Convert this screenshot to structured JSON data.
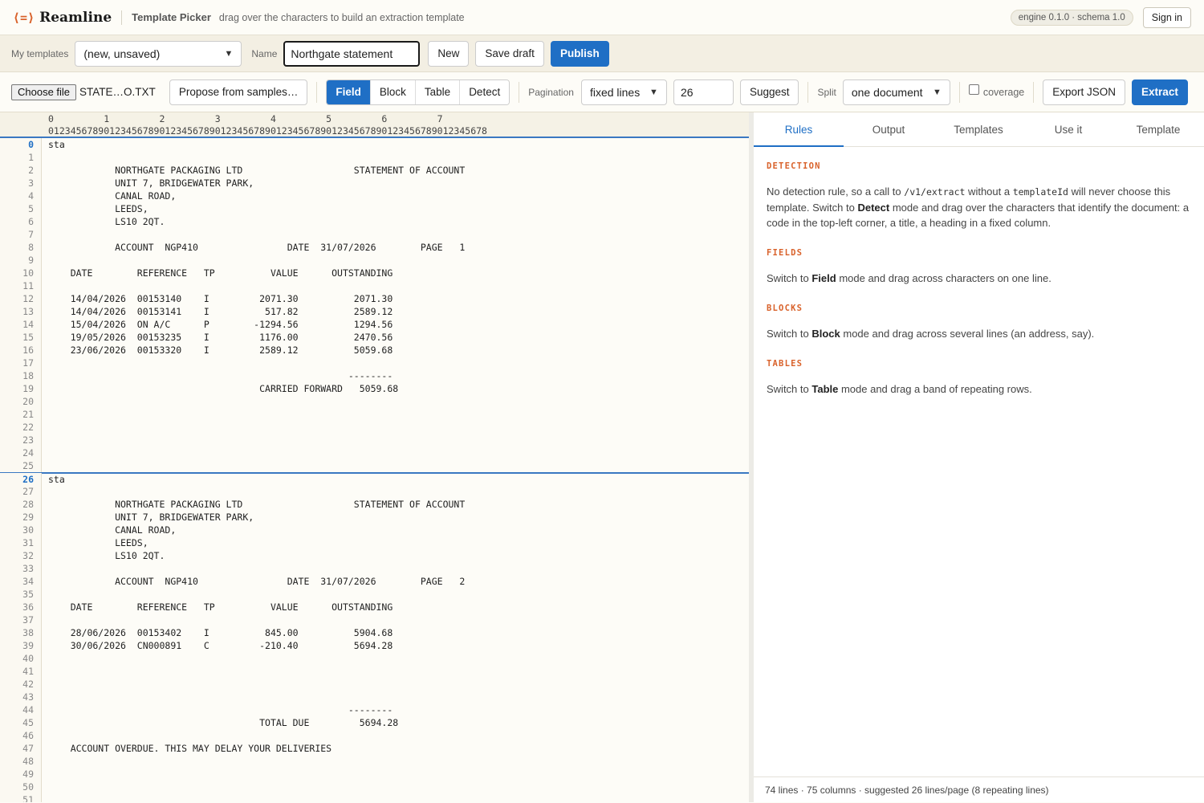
{
  "header": {
    "logo_mark": "⟨=⟩",
    "app_name": "Reamline",
    "title": "Template Picker",
    "hint": "drag over the characters to build an extraction template",
    "engine_badge": "engine 0.1.0 · schema 1.0",
    "signin_label": "Sign in"
  },
  "template_bar": {
    "my_templates_label": "My templates",
    "my_templates_value": "(new, unsaved)",
    "name_label": "Name",
    "name_value": "Northgate statement",
    "new_label": "New",
    "save_draft_label": "Save draft",
    "publish_label": "Publish"
  },
  "toolbar": {
    "choose_file_label": "Choose file",
    "file_name": "STATE…O.TXT",
    "propose_label": "Propose from samples…",
    "modes": [
      "Field",
      "Block",
      "Table",
      "Detect"
    ],
    "active_mode": "Field",
    "pagination_label": "Pagination",
    "pagination_value": "fixed lines",
    "lines_per_page": "26",
    "suggest_label": "Suggest",
    "split_label": "Split",
    "split_value": "one document",
    "coverage_label": "coverage",
    "export_label": "Export JSON",
    "extract_label": "Extract"
  },
  "ruler": {
    "tens": "0         1         2         3         4         5         6         7",
    "units": "0123456789012345678901234567890123456789012345678901234567890123456789012345678"
  },
  "document": {
    "lines": [
      "sta",
      "",
      "            NORTHGATE PACKAGING LTD                    STATEMENT OF ACCOUNT",
      "            UNIT 7, BRIDGEWATER PARK,",
      "            CANAL ROAD,",
      "            LEEDS,",
      "            LS10 2QT.",
      "",
      "            ACCOUNT  NGP410                DATE  31/07/2026        PAGE   1",
      "",
      "    DATE        REFERENCE   TP          VALUE      OUTSTANDING",
      "",
      "    14/04/2026  00153140    I         2071.30          2071.30",
      "    14/04/2026  00153141    I          517.82          2589.12",
      "    15/04/2026  ON A/C      P        -1294.56          1294.56",
      "    19/05/2026  00153235    I         1176.00          2470.56",
      "    23/06/2026  00153320    I         2589.12          5059.68",
      "",
      "                                                      --------",
      "                                      CARRIED FORWARD   5059.68",
      "",
      "",
      "",
      "",
      "",
      "",
      "sta",
      "",
      "            NORTHGATE PACKAGING LTD                    STATEMENT OF ACCOUNT",
      "            UNIT 7, BRIDGEWATER PARK,",
      "            CANAL ROAD,",
      "            LEEDS,",
      "            LS10 2QT.",
      "",
      "            ACCOUNT  NGP410                DATE  31/07/2026        PAGE   2",
      "",
      "    DATE        REFERENCE   TP          VALUE      OUTSTANDING",
      "",
      "    28/06/2026  00153402    I          845.00          5904.68",
      "    30/06/2026  CN000891    C         -210.40          5694.28",
      "",
      "",
      "",
      "",
      "                                                      --------",
      "                                      TOTAL DUE         5694.28",
      "",
      "    ACCOUNT OVERDUE. THIS MAY DELAY YOUR DELIVERIES",
      "",
      "",
      "",
      ""
    ]
  },
  "right_panel": {
    "tabs": [
      "Rules",
      "Output",
      "Templates",
      "Use it",
      "Template"
    ],
    "active_tab": "Rules",
    "detection": {
      "heading": "DETECTION",
      "t1": "No detection rule, so a call to ",
      "code1": "/v1/extract",
      "t2": " without a ",
      "code2": "templateId",
      "t3": " will never choose this template. Switch to ",
      "bold": "Detect",
      "t4": " mode and drag over the characters that identify the document: a code in the top-left corner, a title, a heading in a fixed column."
    },
    "fields": {
      "heading": "FIELDS",
      "t1": "Switch to ",
      "bold": "Field",
      "t2": " mode and drag across characters on one line."
    },
    "blocks": {
      "heading": "BLOCKS",
      "t1": "Switch to ",
      "bold": "Block",
      "t2": " mode and drag across several lines (an address, say)."
    },
    "tables": {
      "heading": "TABLES",
      "t1": "Switch to ",
      "bold": "Table",
      "t2": " mode and drag a band of repeating rows."
    },
    "footer": "74 lines · 75 columns · suggested 26 lines/page (8 repeating lines)"
  },
  "colors": {
    "accent": "#1f6fc5",
    "brand": "#d9622b",
    "background": "#fdfcf7"
  },
  "icons": {
    "logo": "logo-icon",
    "dropdown": "chevron-down-icon"
  }
}
